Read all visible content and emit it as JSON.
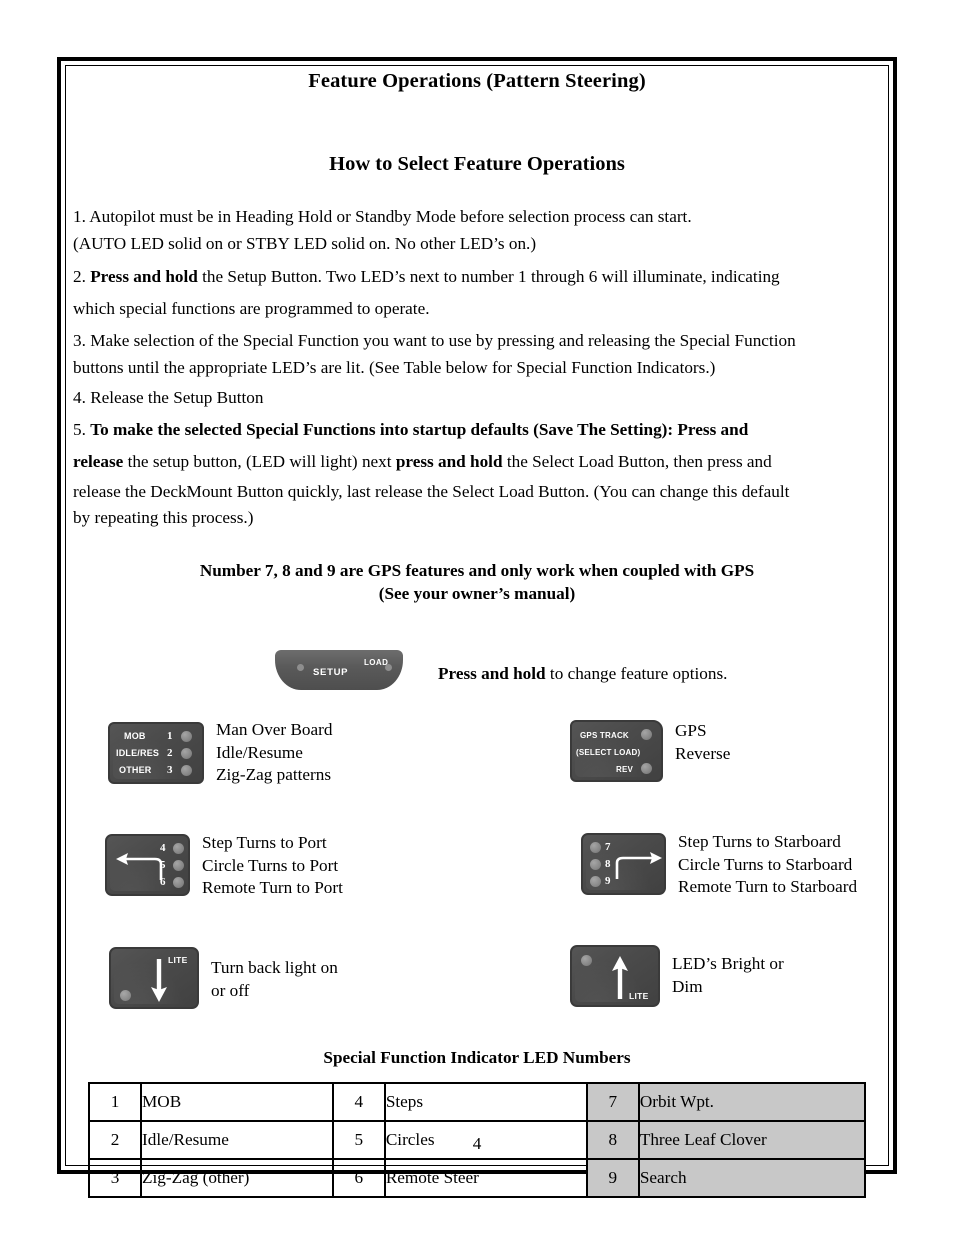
{
  "document": {
    "title": "Feature Operations (Pattern Steering)",
    "subtitle": "How to Select Feature Operations",
    "page_number": "4"
  },
  "steps": {
    "item1_line1": "1.  Autopilot must be in Heading Hold or Standby Mode before selection process can start.",
    "item1_line2": "(AUTO LED solid on or STBY LED solid on.  No other LED’s on.)",
    "item2_number": "2.",
    "item2_bold": "Press and hold",
    "item2_rest": "the Setup Button.  Two LED’s next to number 1 through 6 will illuminate, indicating",
    "item2_line2": "which  special functions are programmed to operate.",
    "item3_line1": "3.  Make selection of the Special Function you want to use by pressing and releasing the Special Function",
    "item3_line2": "buttons until the appropriate LED’s are lit.  (See Table below for Special Function Indicators.)",
    "item4": "4.  Release the Setup Button",
    "item5_number": "5.",
    "item5_bold1": "To make the selected Special Functions into startup defaults (Save The Setting):  Press and",
    "item5_bold2": "release",
    "item5_mid": "the setup button, (LED will light) next",
    "item5_bold3": "press and hold",
    "item5_rest": "the Select Load Button, then press and",
    "item5_line3": "release the DeckMount Button quickly, last release the Select Load Button.  (You can change this default",
    "item5_line4": "by repeating this process.)"
  },
  "gps_note": {
    "line1": "Number 7, 8 and 9 are GPS features and only work when coupled with GPS",
    "line2": "(See your owner’s manual)"
  },
  "setup_button": {
    "setup_label": "SETUP",
    "load_label": "LOAD",
    "caption_bold": "Press and hold",
    "caption_rest": "to change feature options."
  },
  "panels": [
    {
      "id": "mob",
      "labels": [
        "MOB",
        "IDLE/RES",
        "OTHER"
      ],
      "numbers": [
        "1",
        "2",
        "3"
      ],
      "caption_lines": [
        "Man Over Board",
        "Idle/Resume",
        "Zig-Zag patterns"
      ]
    },
    {
      "id": "gps",
      "labels": [
        "GPS TRACK",
        "(SELECT LOAD)",
        "REV"
      ],
      "numbers": [],
      "caption_lines": [
        "GPS",
        "Reverse"
      ]
    },
    {
      "id": "port",
      "labels": [],
      "numbers": [
        "4",
        "5",
        "6"
      ],
      "caption_lines": [
        "Step Turns to Port",
        "Circle Turns to Port",
        "Remote Turn to Port"
      ]
    },
    {
      "id": "starboard",
      "labels": [],
      "numbers": [
        "7",
        "8",
        "9"
      ],
      "caption_lines": [
        "Step Turns to Starboard",
        "Circle Turns to Starboard",
        "Remote Turn to Starboard"
      ]
    },
    {
      "id": "backlight",
      "labels": [
        "LITE"
      ],
      "numbers": [],
      "caption_lines": [
        "Turn back light on",
        "or off"
      ]
    },
    {
      "id": "brightness",
      "labels": [
        "LITE"
      ],
      "numbers": [],
      "caption_lines": [
        "LED’s Bright or",
        "Dim"
      ]
    }
  ],
  "table": {
    "title": "Special Function Indicator LED Numbers",
    "rows": [
      {
        "n1": "1",
        "f1": "MOB",
        "n2": "4",
        "f2": "Steps",
        "n3": "7",
        "f3": "Orbit Wpt."
      },
      {
        "n1": "2",
        "f1": "Idle/Resume",
        "n2": "5",
        "f2": "Circles",
        "n3": "8",
        "f3": "Three Leaf Clover"
      },
      {
        "n1": "3",
        "f1": "Zig-Zag (other)",
        "n2": "6",
        "f2": "Remote Steer",
        "n3": "9",
        "f3": "Search"
      }
    ],
    "shaded_color": "#c8c8c8"
  },
  "colors": {
    "panel_face": "#4a4a4a",
    "led": "#8b8b8b",
    "text": "#000000"
  }
}
